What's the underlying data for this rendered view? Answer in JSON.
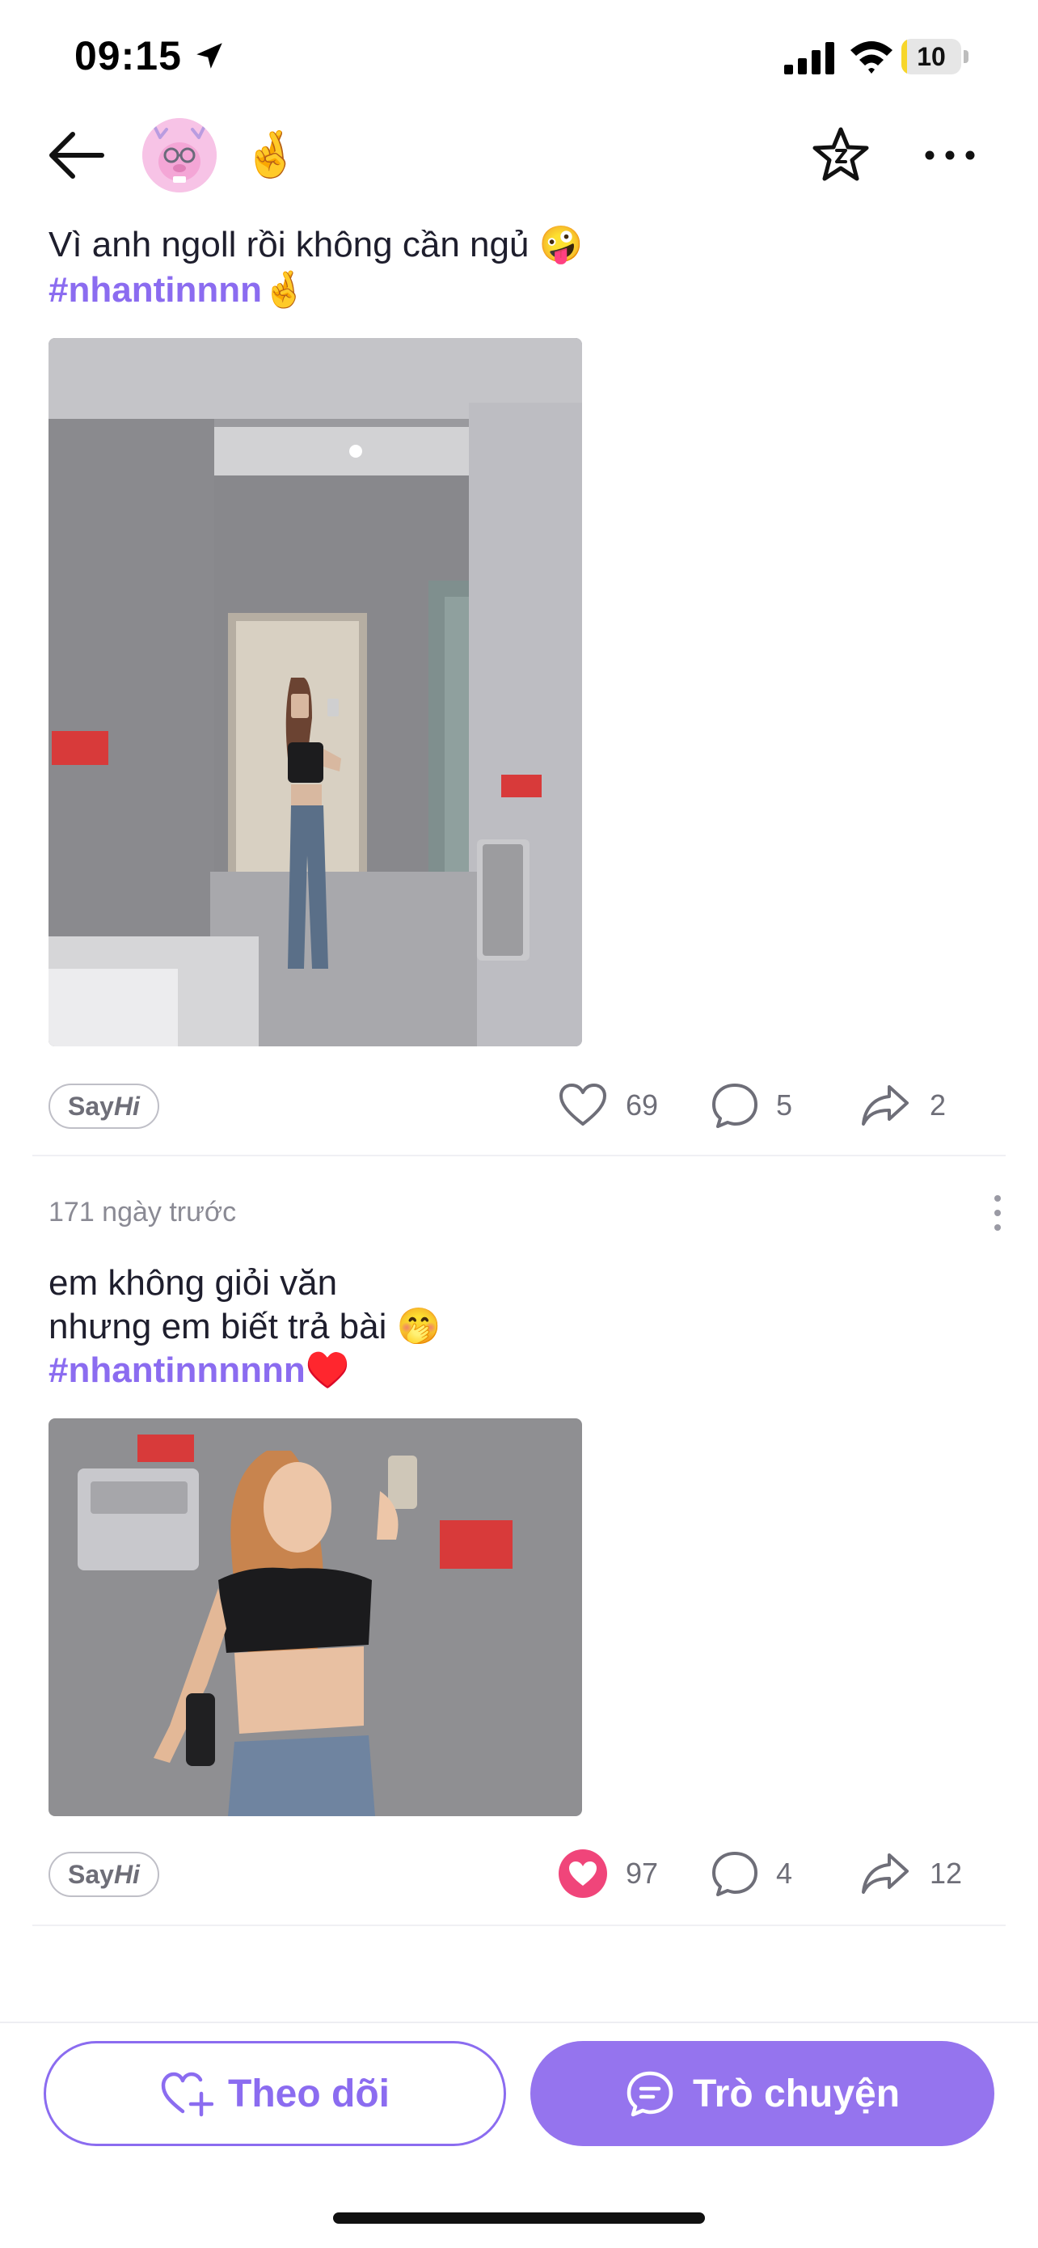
{
  "status_bar": {
    "time": "09:15",
    "battery": "10",
    "battery_level": 0.1
  },
  "header": {
    "hand_emoji": "🤞"
  },
  "post1": {
    "text_line": "Vì anh ngoll rồi không cần ngủ",
    "text_emoji": "🤪",
    "hashtag": "#nhantinnnn",
    "hashtag_emoji": "🤞",
    "say_hi_a": "Say",
    "say_hi_b": "Hi",
    "likes": "69",
    "comments": "5",
    "shares": "2",
    "liked": false
  },
  "post2": {
    "timestamp": "171 ngày trước",
    "text_line1": "em không giỏi văn",
    "text_line2": "nhưng em biết trả bài",
    "text_emoji": "🤭",
    "hashtag": "#nhantinnnnnn",
    "hashtag_emoji": "♥️",
    "say_hi_a": "Say",
    "say_hi_b": "Hi",
    "likes": "97",
    "comments": "4",
    "shares": "12",
    "liked": true
  },
  "bottom": {
    "follow_label": "Theo dõi",
    "chat_label": "Trò chuyện"
  },
  "colors": {
    "accent": "#8b6cf0",
    "like_active": "#f0457a",
    "text": "#1e1e2d",
    "muted": "#6e6e78"
  }
}
